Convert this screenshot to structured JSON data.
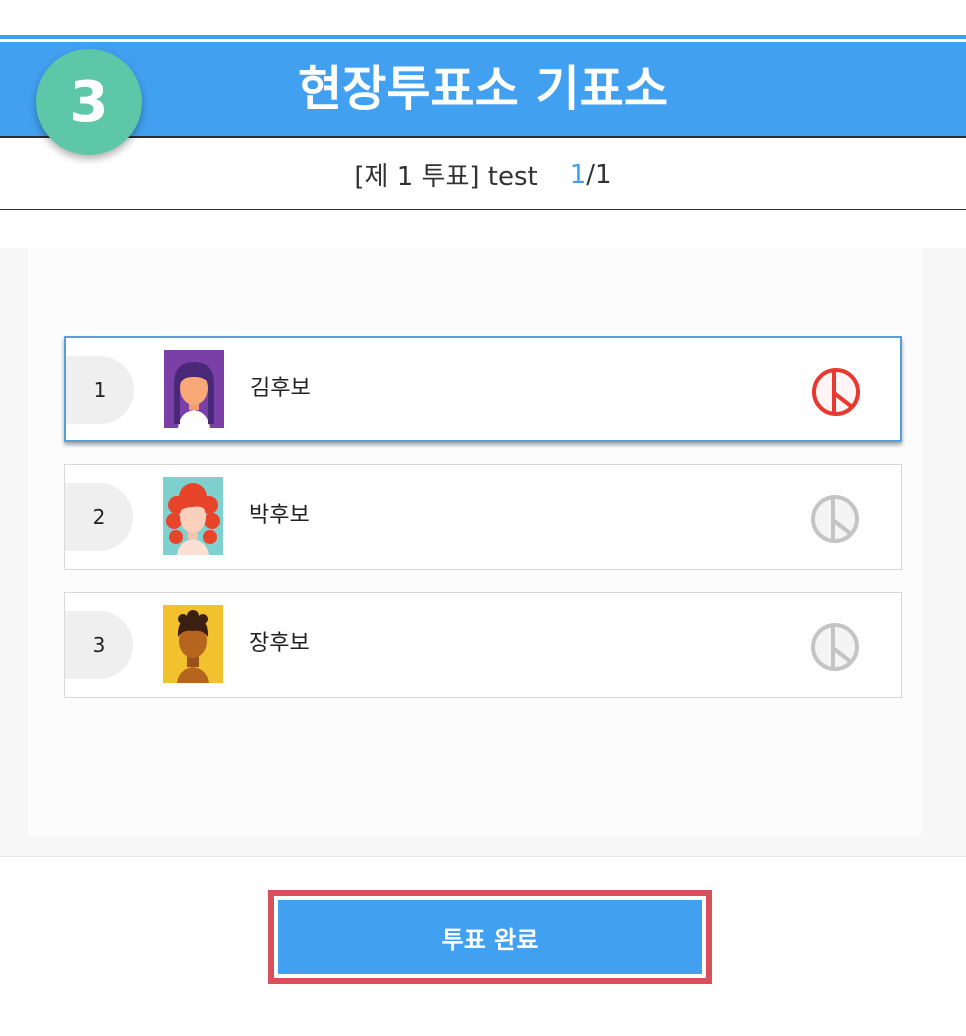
{
  "header": {
    "step_number": "3",
    "title": "현장투표소 기표소"
  },
  "ballot": {
    "label": "[제 1 투표] test",
    "page_current": "1",
    "page_total": "/1"
  },
  "candidates": [
    {
      "number": "1",
      "name": "김후보",
      "selected": true,
      "avatar": "woman-purple-hair-avatar"
    },
    {
      "number": "2",
      "name": "박후보",
      "selected": false,
      "avatar": "woman-red-curly-hair-avatar"
    },
    {
      "number": "3",
      "name": "장후보",
      "selected": false,
      "avatar": "man-dark-hair-avatar"
    }
  ],
  "submit": {
    "label": "투표 완료"
  },
  "colors": {
    "accent": "#42a0f0",
    "badge": "#5ec7a8",
    "stamp_selected": "#e8382f",
    "stamp_unselected": "#c4c4c4",
    "highlight_outline": "#d9505a"
  },
  "icons": {
    "vote_stamp": "vote-stamp-icon"
  }
}
